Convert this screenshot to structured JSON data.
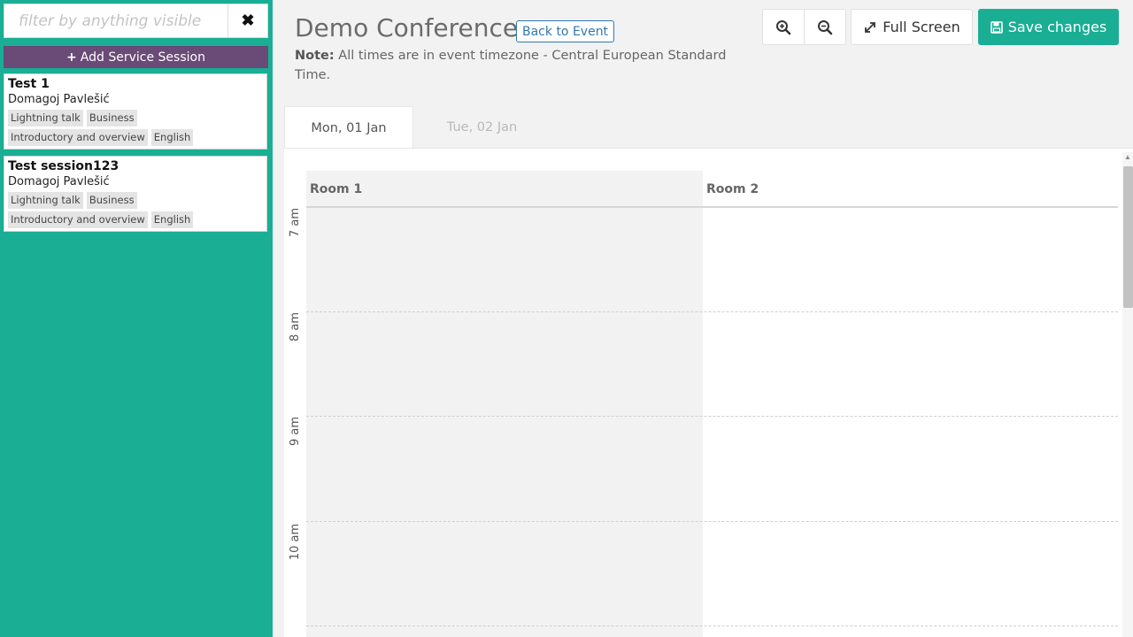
{
  "sidebar": {
    "filter_placeholder": "filter by anything visible",
    "clear_icon": "✖",
    "add_session_label": "Add Service Session",
    "sessions": [
      {
        "title": "Test 1",
        "speaker": "Domagoj Pavlešić",
        "tags_row1": [
          "Lightning talk",
          "Business"
        ],
        "tags_row2": [
          "Introductory and overview",
          "English"
        ]
      },
      {
        "title": "Test session123",
        "speaker": "Domagoj Pavlešić",
        "tags_row1": [
          "Lightning talk",
          "Business"
        ],
        "tags_row2": [
          "Introductory and overview",
          "English"
        ]
      }
    ]
  },
  "header": {
    "title": "Demo Conference",
    "back_label": "Back to Event",
    "note_label": "Note:",
    "note_text": "All times are in event timezone - Central European Standard Time."
  },
  "toolbar": {
    "fullscreen_label": "Full Screen",
    "save_label": "Save changes"
  },
  "tabs": [
    {
      "label": "Mon, 01 Jan",
      "active": true
    },
    {
      "label": "Tue, 02 Jan",
      "active": false
    }
  ],
  "calendar": {
    "rooms": [
      "Room 1",
      "Room 2"
    ],
    "hours": [
      "7 am",
      "8 am",
      "9 am",
      "10 am"
    ]
  },
  "colors": {
    "sidebar_bg": "#1aae94",
    "add_session_bg": "#6a4a77",
    "accent": "#1aae94",
    "link": "#3277b3"
  }
}
